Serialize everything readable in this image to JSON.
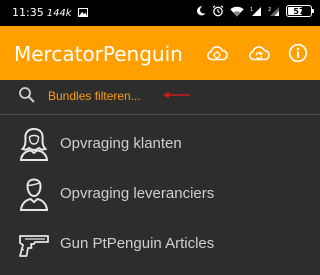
{
  "status_bar": {
    "time": "11:35",
    "network_speed": "144k",
    "battery_level": "57"
  },
  "app_bar": {
    "title": "MercatorPenguin",
    "background_color": "#ffa000",
    "actions": [
      {
        "icon": "cloud-settings-icon"
      },
      {
        "icon": "cloud-sync-icon"
      },
      {
        "icon": "info-icon"
      }
    ]
  },
  "search": {
    "placeholder": "Bundles filteren...",
    "text_color": "#ff9f10",
    "annotation_arrow_color": "#cc1b1b"
  },
  "list": {
    "items": [
      {
        "label": "Opvraging klanten",
        "icon": "woman-avatar-icon"
      },
      {
        "label": "Opvraging leveranciers",
        "icon": "man-avatar-icon"
      },
      {
        "label": "Gun PtPenguin Articles",
        "icon": "gun-icon"
      }
    ]
  }
}
